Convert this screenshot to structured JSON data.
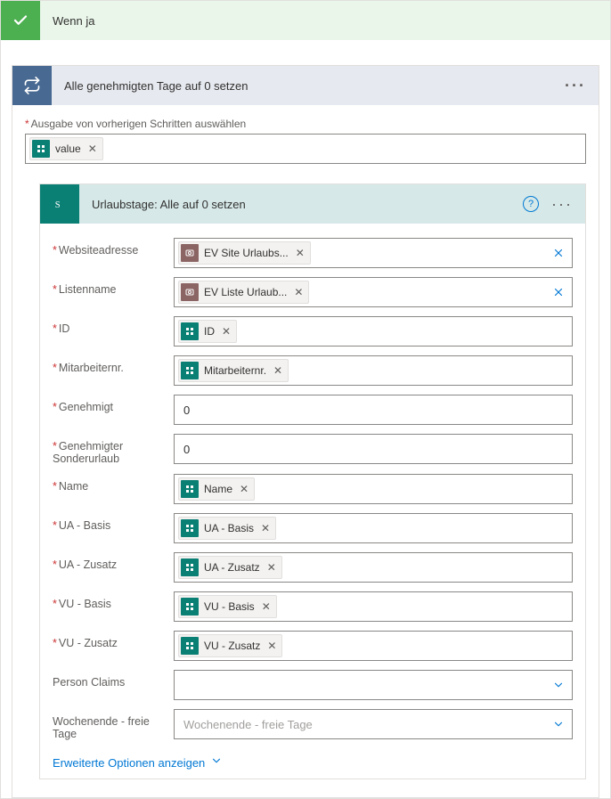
{
  "condition_branch": {
    "title": "Wenn ja"
  },
  "loop": {
    "title": "Alle genehmigten Tage auf 0 setzen",
    "select_label": "Ausgabe von vorherigen Schritten auswählen",
    "select_token": "value"
  },
  "action": {
    "title": "Urlaubstage: Alle auf 0 setzen",
    "advanced_label": "Erweiterte Optionen anzeigen",
    "fields": [
      {
        "label": "Websiteadresse",
        "required": true,
        "type": "token-env",
        "token": "EV Site Urlaubs...",
        "clear": true
      },
      {
        "label": "Listenname",
        "required": true,
        "type": "token-env",
        "token": "EV Liste Urlaub...",
        "clear": true
      },
      {
        "label": "ID",
        "required": true,
        "type": "token-sp",
        "token": "ID"
      },
      {
        "label": "Mitarbeiternr.",
        "required": true,
        "type": "token-sp",
        "token": "Mitarbeiternr."
      },
      {
        "label": "Genehmigt",
        "required": true,
        "type": "text",
        "value": "0"
      },
      {
        "label": "Genehmigter Sonderurlaub",
        "required": true,
        "type": "text",
        "value": "0"
      },
      {
        "label": "Name",
        "required": true,
        "type": "token-sp",
        "token": "Name"
      },
      {
        "label": "UA - Basis",
        "required": true,
        "type": "token-sp",
        "token": "UA - Basis"
      },
      {
        "label": "UA - Zusatz",
        "required": true,
        "type": "token-sp",
        "token": "UA - Zusatz"
      },
      {
        "label": "VU - Basis",
        "required": true,
        "type": "token-sp",
        "token": "VU - Basis"
      },
      {
        "label": "VU - Zusatz",
        "required": true,
        "type": "token-sp",
        "token": "VU - Zusatz"
      },
      {
        "label": "Person Claims",
        "required": false,
        "type": "dropdown",
        "placeholder": ""
      },
      {
        "label": "Wochenende - freie Tage",
        "required": false,
        "type": "dropdown",
        "placeholder": "Wochenende - freie Tage"
      }
    ]
  }
}
